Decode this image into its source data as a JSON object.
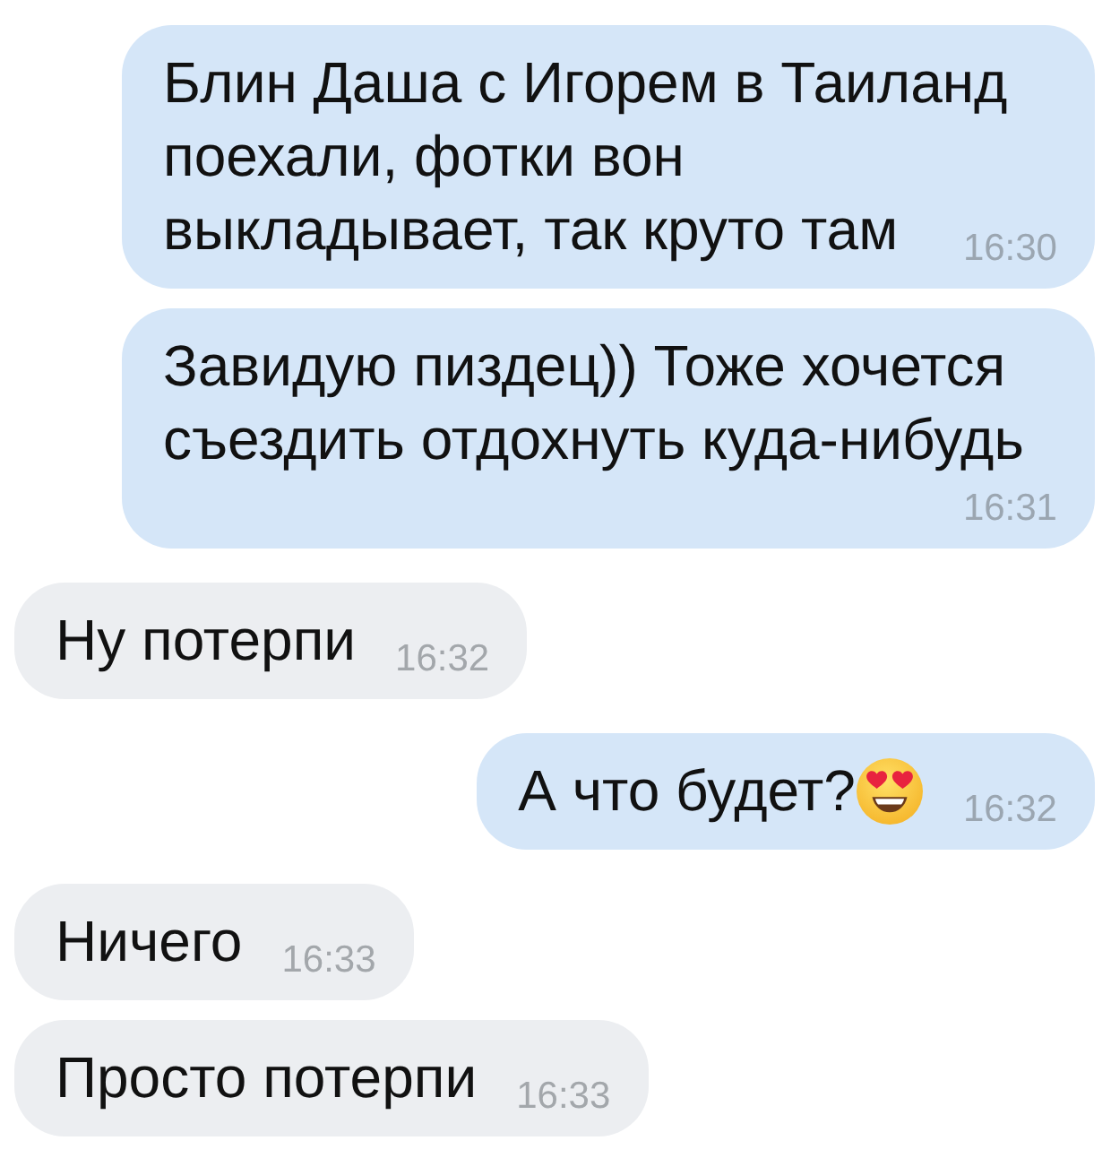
{
  "messages": [
    {
      "kind": "outgoing",
      "lines": [
        "Блин Даша с Игорем в Таиланд",
        "поехали, фотки вон",
        "выкладывает, так круто там"
      ],
      "time": "16:30",
      "has_emoji": false
    },
    {
      "kind": "outgoing",
      "lines": [
        "Завидую пиздец)) Тоже хочется",
        "съездить отдохнуть куда-нибудь"
      ],
      "time": "16:31",
      "has_emoji": false
    },
    {
      "kind": "incoming",
      "lines": [
        "Ну потерпи"
      ],
      "time": "16:32",
      "has_emoji": false
    },
    {
      "kind": "outgoing",
      "lines": [
        "А что будет?"
      ],
      "time": "16:32",
      "has_emoji": true
    },
    {
      "kind": "incoming",
      "lines": [
        "Ничего"
      ],
      "time": "16:33",
      "has_emoji": false
    },
    {
      "kind": "incoming",
      "lines": [
        "Просто потерпи"
      ],
      "time": "16:33",
      "has_emoji": false
    }
  ]
}
